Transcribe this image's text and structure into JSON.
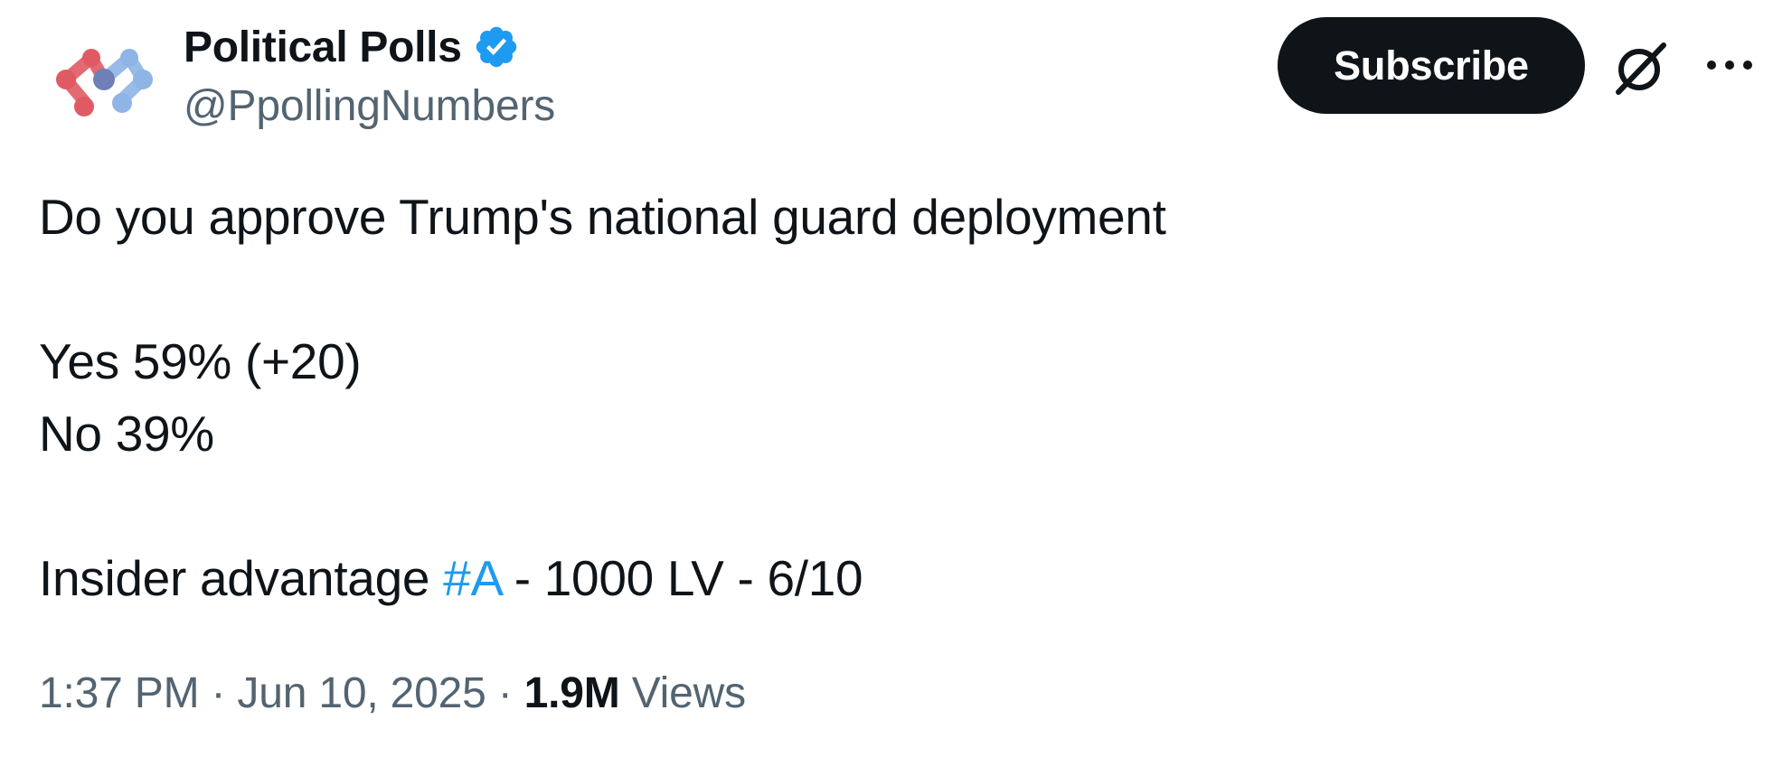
{
  "author": {
    "display_name": "Political Polls",
    "handle": "@PpollingNumbers",
    "verified_icon": "verified-badge-icon",
    "avatar_colors": [
      "#e05a63",
      "#6f7fb8",
      "#8fb4e6"
    ]
  },
  "actions": {
    "subscribe_label": "Subscribe",
    "grok_icon": "grok-icon",
    "more_icon": "more-options-icon"
  },
  "tweet": {
    "line_1": "Do you approve Trump's national guard deployment",
    "line_2": "Yes 59% (+20)",
    "line_3": "No 39%",
    "line_4_prefix": "Insider advantage ",
    "line_4_hashtag": "#A",
    "line_4_suffix": " - 1000 LV - 6/10"
  },
  "meta": {
    "time": "1:37 PM",
    "separator": " · ",
    "date": "Jun 10, 2025",
    "views_count": "1.9M",
    "views_label": " Views"
  },
  "colors": {
    "text_primary": "#0f1419",
    "text_secondary": "#536471",
    "link": "#1d9bf0",
    "verified": "#1d9bf0",
    "button_bg": "#0f1419"
  }
}
